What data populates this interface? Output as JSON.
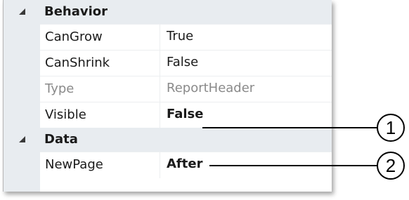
{
  "categories": [
    {
      "label": "Behavior",
      "icon": "collapse-triangle-icon",
      "properties": [
        {
          "name": "CanGrow",
          "value": "True"
        },
        {
          "name": "CanShrink",
          "value": "False"
        },
        {
          "name": "Type",
          "value": "ReportHeader"
        },
        {
          "name": "Visible",
          "value": "False"
        }
      ]
    },
    {
      "label": "Data",
      "icon": "collapse-triangle-icon",
      "properties": [
        {
          "name": "NewPage",
          "value": "After"
        }
      ]
    }
  ],
  "callouts": [
    {
      "number": "1"
    },
    {
      "number": "2"
    }
  ]
}
